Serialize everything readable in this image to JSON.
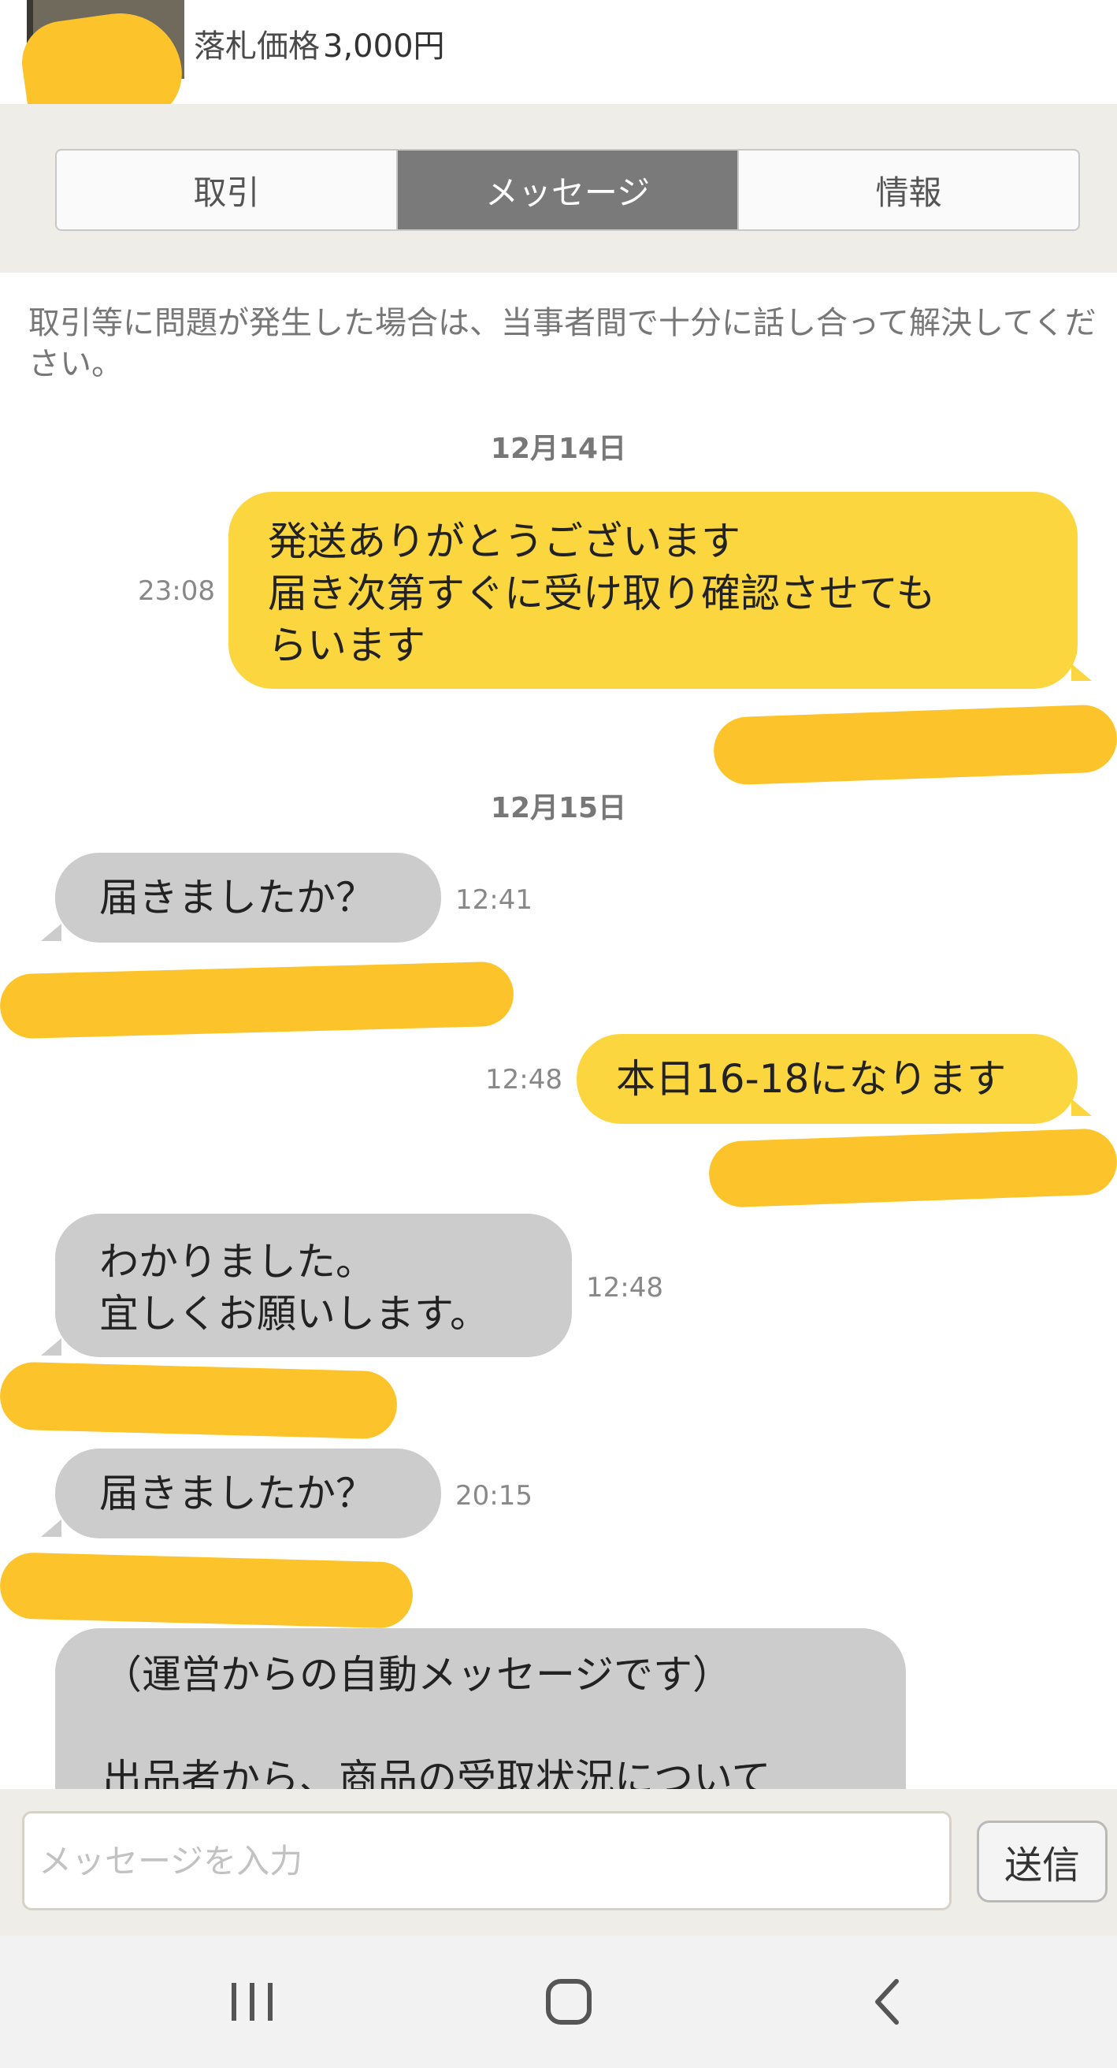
{
  "header": {
    "price_label": "落札価格",
    "price_value": "3,000円"
  },
  "tabs": [
    {
      "label": "取引",
      "active": false
    },
    {
      "label": "メッセージ",
      "active": true
    },
    {
      "label": "情報",
      "active": false
    }
  ],
  "notice": "取引等に問題が発生した場合は、当事者間で十分に話し合って解決してください。",
  "messages": [
    {
      "date": "12月14日"
    },
    {
      "from": "me",
      "time": "23:08",
      "text": "発送ありがとうございます\n届き次第すぐに受け取り確認させても\nらいます"
    },
    {
      "date": "12月15日"
    },
    {
      "from": "them",
      "time": "12:41",
      "text": "届きましたか？"
    },
    {
      "from": "me",
      "time": "12:48",
      "text": "本日16-18になります"
    },
    {
      "from": "them",
      "time": "12:48",
      "text": "わかりました。\n宜しくお願いします。"
    },
    {
      "from": "them",
      "time": "20:15",
      "text": "届きましたか？"
    },
    {
      "from": "them",
      "time": "",
      "text": "（運営からの自動メッセージです）\n\n出品者から、商品の受取状況について"
    }
  ],
  "input": {
    "placeholder": "メッセージを入力",
    "send_label": "送信"
  },
  "nav": {
    "recents": "recents-icon",
    "home": "home-icon",
    "back": "back-icon"
  },
  "colors": {
    "my_bubble": "#fcd63f",
    "their_bubble": "#cccccc",
    "active_tab": "#7a7a7a",
    "redaction": "#fdc32a"
  }
}
